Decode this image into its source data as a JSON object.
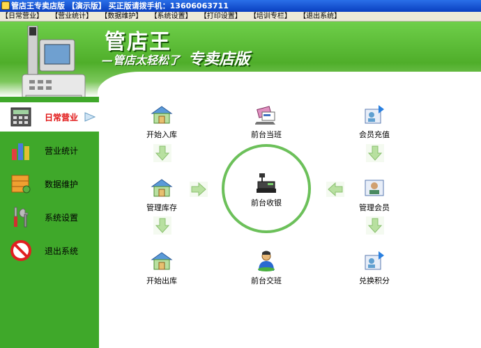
{
  "window": {
    "title": "管店王专卖店版 【演示版】 买正版请拨手机：13606063711"
  },
  "menu": [
    "【日常营业】",
    "【营业统计】",
    "【数据维护】",
    "【系统设置】",
    "【打印设置】",
    "【培训专栏】",
    "【退出系统】"
  ],
  "banner": {
    "title": "管店王",
    "subtitle": "—管店太轻松了",
    "edition": "专卖店版"
  },
  "sidebar": {
    "items": [
      {
        "label": "日常营业",
        "icon": "calculator-icon",
        "active": true
      },
      {
        "label": "营业统计",
        "icon": "bar-chart-icon",
        "active": false
      },
      {
        "label": "数据维护",
        "icon": "database-icon",
        "active": false
      },
      {
        "label": "系统设置",
        "icon": "tools-icon",
        "active": false
      },
      {
        "label": "退出系统",
        "icon": "no-entry-icon",
        "active": false
      }
    ]
  },
  "workflow": {
    "stock_in": "开始入库",
    "shift_start": "前台当班",
    "member_topup": "会员充值",
    "manage_stock": "管理库存",
    "cashier": "前台收银",
    "manage_members": "管理会员",
    "stock_out": "开始出库",
    "shift_handover": "前台交班",
    "redeem_points": "兑换积分"
  },
  "colors": {
    "sidebar": "#3fa82a",
    "banner": "#4fae2a",
    "active_label": "#e01010",
    "circle": "#6cc05a",
    "arrow": "#b8e0a0"
  }
}
